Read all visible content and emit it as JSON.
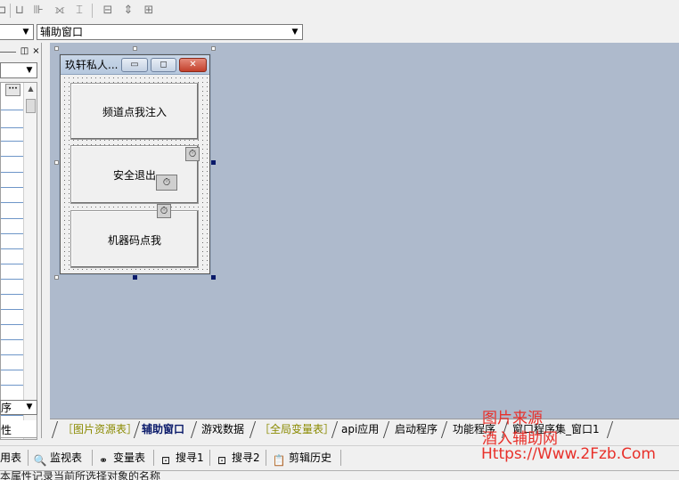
{
  "toolbar": {
    "icons": [
      "align-left-icon",
      "align-top-icon",
      "align-distribute-icon",
      "same-width-icon",
      "same-height-icon",
      "horizontal-space-icon",
      "vertical-space-icon",
      "center-icon"
    ]
  },
  "combo_object": {
    "value": ""
  },
  "combo_window": {
    "value": "辅助窗口"
  },
  "left_panel": {
    "ellipsis_label": "···",
    "bottom_combo_value": "序",
    "tab_label": "性"
  },
  "form": {
    "title": "玖轩私人...",
    "buttons": [
      {
        "label": "频道点我注入"
      },
      {
        "label": "安全退出"
      },
      {
        "label": "机器码点我"
      }
    ]
  },
  "tabs": [
    {
      "label": "［图片资源表］",
      "active": false
    },
    {
      "label": "辅助窗口",
      "active": true
    },
    {
      "label": "游戏数据",
      "active": false
    },
    {
      "label": "［全局变量表］",
      "active": false
    },
    {
      "label": "api应用",
      "active": false
    },
    {
      "label": "启动程序",
      "active": false
    },
    {
      "label": "功能程序",
      "active": false
    },
    {
      "label": "窗口程序集_窗口1",
      "active": false
    }
  ],
  "bottom_bar": {
    "items": [
      {
        "label": "用表",
        "icon": ""
      },
      {
        "label": "监视表",
        "icon": "magnifier-icon"
      },
      {
        "label": "变量表",
        "icon": "variables-icon"
      },
      {
        "label": "搜寻1",
        "icon": "search-window-icon"
      },
      {
        "label": "搜寻2",
        "icon": "search-window-icon"
      },
      {
        "label": "剪辑历史",
        "icon": "clipboard-icon"
      }
    ]
  },
  "status": {
    "text": "本属性记录当前所选择对象的名称"
  },
  "watermark": {
    "line1": "图片来源",
    "line2": "酒入辅助网",
    "line3": "Https://Www.2Fzb.Com"
  },
  "colors": {
    "designer_bg": "#aebacc",
    "watermark": "#e8302a",
    "active_tab": "#0a1a6a"
  }
}
